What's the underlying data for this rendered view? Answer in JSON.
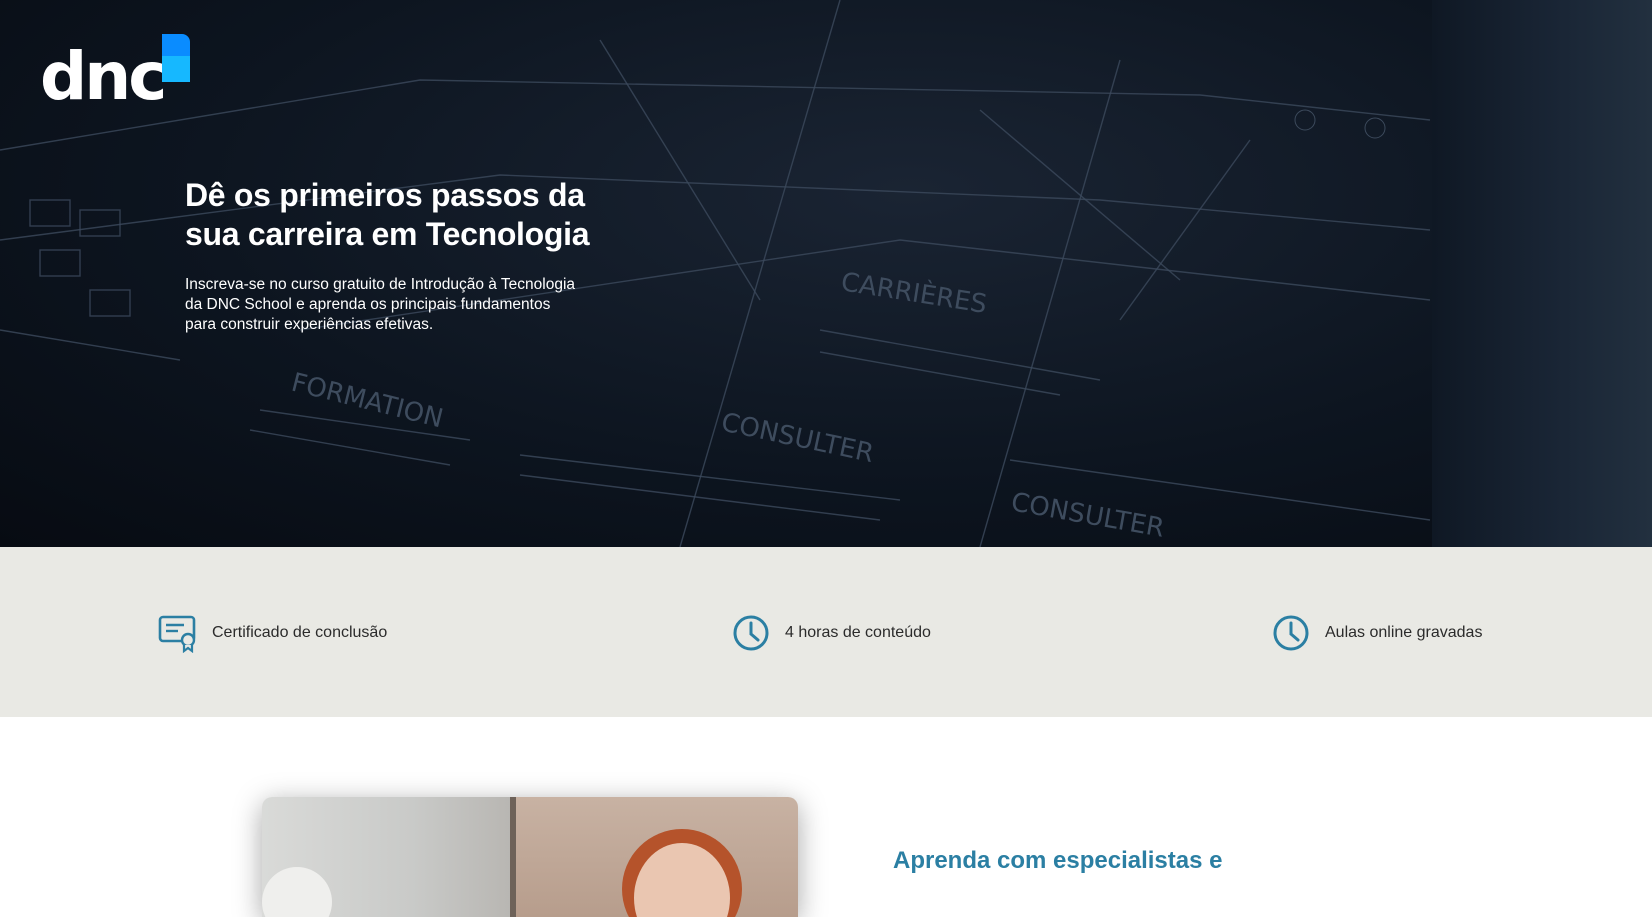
{
  "brand": {
    "logo_text": "dnc",
    "colors": {
      "primary": "#0a8cff",
      "secondary": "#16b8ff",
      "accent_text": "#2b7fa3",
      "feature_bg": "#e9e9e4"
    }
  },
  "hero": {
    "title": "Dê os primeiros passos da sua carreira em Tecnologia",
    "subtitle": "Inscreva-se no curso gratuito de Introdução à Tecnologia da DNC School e aprenda os principais fundamentos para construir experiências efetivas.",
    "background_words": [
      "FORMATION",
      "CARRIÈRES",
      "CONSULTER",
      "CONSULTER"
    ]
  },
  "features": [
    {
      "icon": "certificate-icon",
      "label": "Certificado de conclusão"
    },
    {
      "icon": "clock-icon",
      "label": "4 horas de conteúdo"
    },
    {
      "icon": "clock-icon",
      "label": "Aulas online gravadas"
    }
  ],
  "section": {
    "title": "Aprenda com especialistas e"
  }
}
